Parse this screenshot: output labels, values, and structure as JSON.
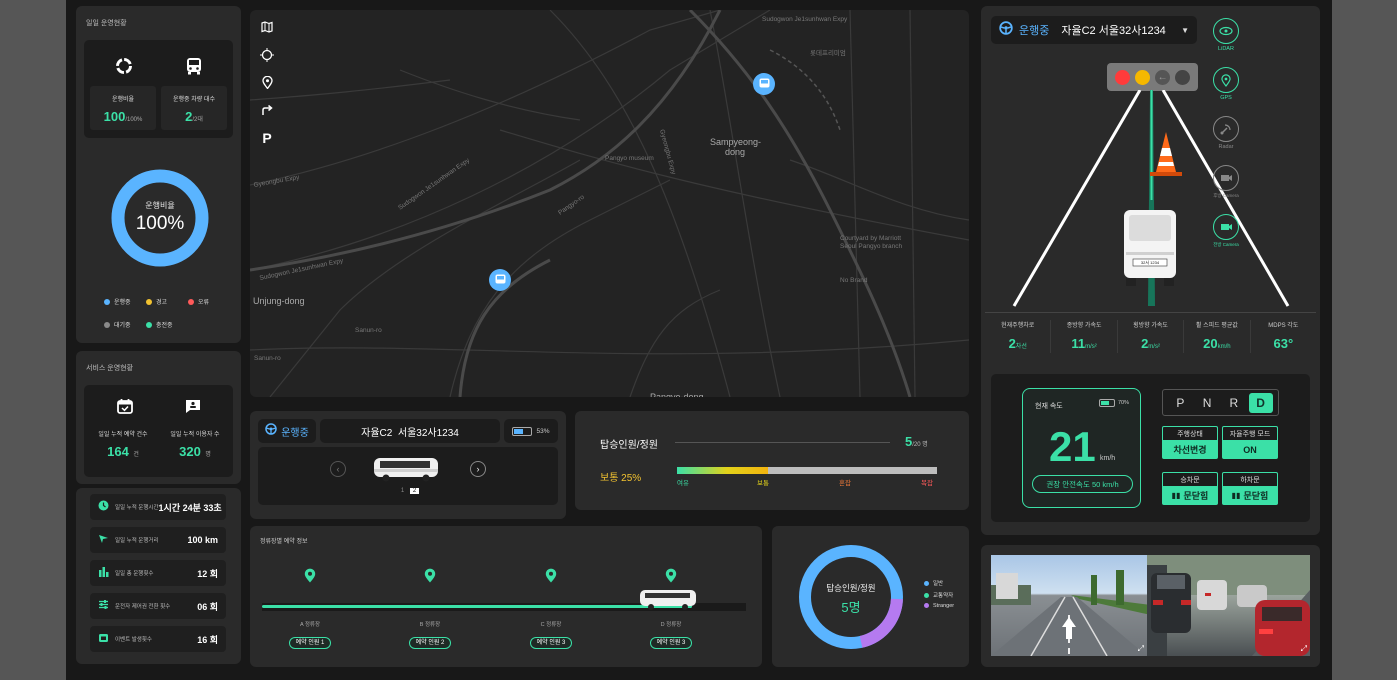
{
  "colors": {
    "accent": "#3be0a7",
    "blue": "#5ab4ff",
    "purple": "#b57af0",
    "warn": "#f2c230",
    "error": "#ff5a5a"
  },
  "left": {
    "daily_title": "일일 운영현황",
    "op_rate_label": "운행비율",
    "op_rate_value": "100",
    "op_rate_unit": "/100%",
    "vehicles_label": "운행중 차량 대수",
    "vehicles_value": "2",
    "vehicles_unit": "/2대",
    "ring_label": "운행비율",
    "ring_value": "100%",
    "ring_fraction": 1.0,
    "legend": [
      {
        "label": "운행중",
        "color": "#5ab4ff"
      },
      {
        "label": "경고",
        "color": "#f2c230"
      },
      {
        "label": "오류",
        "color": "#ff5a5a"
      },
      {
        "label": "대기중",
        "color": "#8a8a8a"
      },
      {
        "label": "충전중",
        "color": "#3be0a7"
      }
    ],
    "service_title": "서비스 운영현황",
    "reserve_label": "일일 누적 예약 건수",
    "reserve_value": "164",
    "reserve_unit": "건",
    "users_label": "일일 누적 이용자 수",
    "users_value": "320",
    "users_unit": "명",
    "stats": [
      {
        "icon": "clock-icon",
        "label": "일일 누적 운행시간",
        "value": "1시간 24분 33초"
      },
      {
        "icon": "distance-icon",
        "label": "일일 누적 운행거리",
        "value": "100 km"
      },
      {
        "icon": "bar-chart-icon",
        "label": "일일 총 운행횟수",
        "value": "12 회"
      },
      {
        "icon": "sliders-icon",
        "label": "운전자 제어권 전환 횟수",
        "value": "06 회"
      },
      {
        "icon": "event-icon",
        "label": "이벤트 발생횟수",
        "value": "16 회"
      }
    ]
  },
  "map": {
    "labels": [
      "Sampyeong-dong",
      "Unjung-dong",
      "Pangyo-ro",
      "Sudogwon Je1sunhwan Expy",
      "Sanun-ro",
      "Pangyo-dong",
      "Gyeongbu Expy",
      "No Brand",
      "Courtyard by Marriott Seoul Pangyo branch"
    ]
  },
  "bus_status": {
    "status": "운행중",
    "name": "자율C2  서울32사1234",
    "battery": "53%",
    "battery_fraction": 0.53,
    "pages": [
      "1",
      "2"
    ]
  },
  "occupancy": {
    "title": "탑승인원/정원",
    "current": "5",
    "capacity": "/20 명",
    "level": "보통 25%",
    "fraction": 0.25,
    "scale": [
      "여유",
      "보통",
      "혼잡",
      "복잡"
    ]
  },
  "stops": {
    "title": "정류장별 예약 정보",
    "items": [
      {
        "name": "A 정류장",
        "resv": "예약 인원 1"
      },
      {
        "name": "B 정류장",
        "resv": "예약 인원 2"
      },
      {
        "name": "C 정류장",
        "resv": "예약 인원 3"
      },
      {
        "name": "D 정류장",
        "resv": "예약 인원 3"
      }
    ]
  },
  "donut": {
    "label": "탑승인원/정원",
    "value": "5명",
    "legend": [
      {
        "label": "일반",
        "color": "#5ab4ff"
      },
      {
        "label": "교통약자",
        "color": "#3be0a7"
      },
      {
        "label": "Stranger",
        "color": "#b57af0"
      }
    ]
  },
  "right": {
    "status": "운행중",
    "vehicle": "자율C2 서울32사1234",
    "sensors": [
      {
        "icon": "lidar-icon",
        "label": "LiDAR",
        "on": true
      },
      {
        "icon": "gps-icon",
        "label": "GPS",
        "on": true
      },
      {
        "icon": "radar-icon",
        "label": "Radar",
        "on": false
      },
      {
        "icon": "camera-icon",
        "label": "후방 Camera",
        "on": false
      },
      {
        "icon": "camera-icon",
        "label": "전방 Camera",
        "on": true
      }
    ],
    "plate": "32서 1234",
    "metrics": [
      {
        "label": "현재주행차로",
        "value": "2",
        "unit": "차선"
      },
      {
        "label": "종방향 가속도",
        "value": "11",
        "unit": "m/s²"
      },
      {
        "label": "횡방향 가속도",
        "value": "2",
        "unit": "m/s²"
      },
      {
        "label": "휠 스피드 평균값",
        "value": "20",
        "unit": "km/h"
      },
      {
        "label": "MDPS 각도",
        "value": "63°",
        "unit": ""
      }
    ],
    "speed_label": "현재 속도",
    "battery": "70%",
    "battery_fraction": 0.7,
    "speed": "21",
    "speed_unit": "km/h",
    "safe_speed": "권장 안전속도 50 km/h",
    "gears": [
      "P",
      "N",
      "R",
      "D"
    ],
    "active_gear": "D",
    "drive_state_label": "주행상태",
    "drive_state_value": "차선변경",
    "auto_mode_label": "자율주행 모드",
    "auto_mode_value": "ON",
    "door_in_label": "승차문",
    "door_in_value": "문닫힘",
    "door_out_label": "하차문",
    "door_out_value": "문닫힘"
  }
}
